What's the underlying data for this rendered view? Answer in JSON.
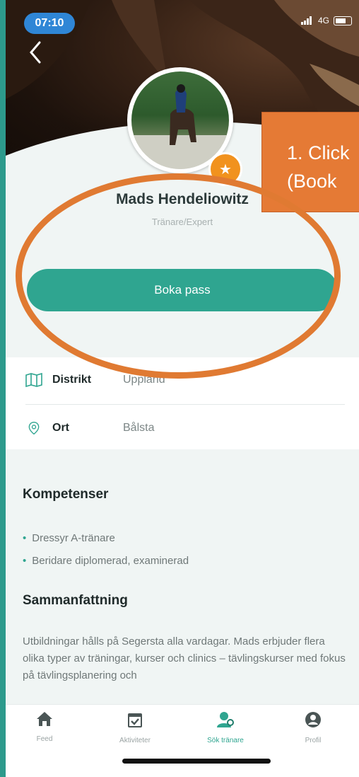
{
  "status": {
    "time": "07:10",
    "network": "4G"
  },
  "profile": {
    "name": "Mads Hendeliowitz",
    "role": "Tränare/Expert",
    "book_button": "Boka pass"
  },
  "info": {
    "district_label": "Distrikt",
    "district_value": "Uppland",
    "city_label": "Ort",
    "city_value": "Bålsta"
  },
  "competencies": {
    "title": "Kompetenser",
    "items": [
      "Dressyr A-tränare",
      "Beridare diplomerad, examinerad"
    ]
  },
  "summary": {
    "title": "Sammanfattning",
    "text": "Utbildningar hålls på Segersta alla vardagar. Mads erbjuder flera olika typer av träningar, kurser och clinics – tävlingskurser med fokus på tävlingsplanering och"
  },
  "tabs": [
    {
      "label": "Feed",
      "icon": "home-icon"
    },
    {
      "label": "Aktiviteter",
      "icon": "calendar-check-icon"
    },
    {
      "label": "Sök tränare",
      "icon": "search-trainer-icon",
      "active": true
    },
    {
      "label": "Profil",
      "icon": "profile-icon"
    }
  ],
  "tutorial": {
    "callout_line1": "1. Click",
    "callout_line2": "(Book",
    "accent_color": "#e57a35"
  },
  "colors": {
    "accent": "#2fa590",
    "badge": "#f1921e"
  }
}
